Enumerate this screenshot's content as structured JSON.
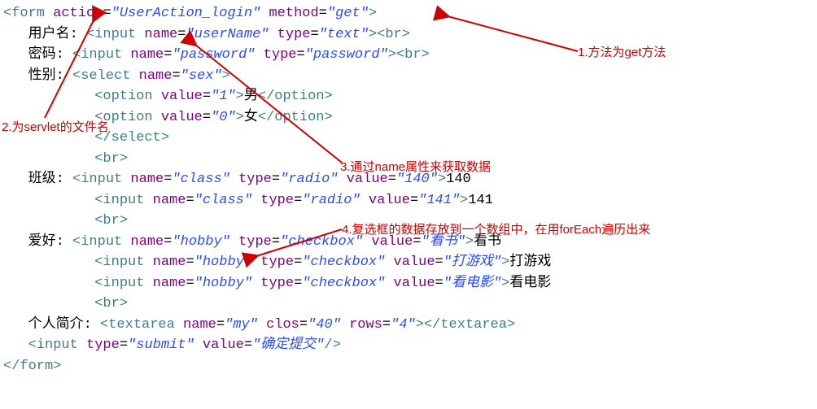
{
  "code": {
    "l1_tag_open": "<form",
    "l1_attr1": " action",
    "l1_eq1": "=",
    "l1_val1": "\"UserAction_login\"",
    "l1_attr2": " method",
    "l1_eq2": "=",
    "l1_val2": "\"get\"",
    "l1_close": ">",
    "l2_pre": "   用户名: ",
    "l2_tag": "<input",
    "l2_a1": " name",
    "l2_e1": "=",
    "l2_v1": "\"userName\"",
    "l2_a2": " type",
    "l2_e2": "=",
    "l2_v2": "\"text\"",
    "l2_close": ">",
    "l2_br": "<br>",
    "l3_pre": "   密码: ",
    "l3_tag": "<input",
    "l3_a1": " name",
    "l3_e1": "=",
    "l3_v1": "\"password\"",
    "l3_a2": " type",
    "l3_e2": "=",
    "l3_v2": "\"password\"",
    "l3_close": ">",
    "l3_br": "<br>",
    "l4_pre": "   性别: ",
    "l4_tag": "<select",
    "l4_a1": " name",
    "l4_e1": "=",
    "l4_v1": "\"sex\"",
    "l4_close": ">",
    "l5_pre": "           ",
    "l5_tag": "<option",
    "l5_a1": " value",
    "l5_e1": "=",
    "l5_v1": "\"1\"",
    "l5_close": ">",
    "l5_text": "男",
    "l5_end": "</option>",
    "l6_pre": "           ",
    "l6_tag": "<option",
    "l6_a1": " value",
    "l6_e1": "=",
    "l6_v1": "\"0\"",
    "l6_close": ">",
    "l6_text": "女",
    "l6_end": "</option>",
    "l7_pre": "           ",
    "l7_end": "</select>",
    "l8_pre": "           ",
    "l8_br": "<br>",
    "l9_pre": "   班级: ",
    "l9_tag": "<input",
    "l9_a1": " name",
    "l9_e1": "=",
    "l9_v1": "\"class\"",
    "l9_a2": " type",
    "l9_e2": "=",
    "l9_v2": "\"radio\"",
    "l9_a3": " value",
    "l9_e3": "=",
    "l9_v3": "\"140\"",
    "l9_close": ">",
    "l9_text": "140",
    "l10_pre": "           ",
    "l10_tag": "<input",
    "l10_a1": " name",
    "l10_e1": "=",
    "l10_v1": "\"class\"",
    "l10_a2": " type",
    "l10_e2": "=",
    "l10_v2": "\"radio\"",
    "l10_a3": " value",
    "l10_e3": "=",
    "l10_v3": "\"141\"",
    "l10_close": ">",
    "l10_text": "141",
    "l11_pre": "           ",
    "l11_br": "<br>",
    "l12_pre": "   爱好: ",
    "l12_tag": "<input",
    "l12_a1": " name",
    "l12_e1": "=",
    "l12_v1": "\"hobby\"",
    "l12_a2": " type",
    "l12_e2": "=",
    "l12_v2": "\"checkbox\"",
    "l12_a3": " value",
    "l12_e3": "=",
    "l12_v3": "\"看书\"",
    "l12_close": ">",
    "l12_text": "看书",
    "l13_pre": "           ",
    "l13_tag": "<input",
    "l13_a1": " name",
    "l13_e1": "=",
    "l13_v1": "\"hobby\"",
    "l13_a2": " type",
    "l13_e2": "=",
    "l13_v2": "\"checkbox\"",
    "l13_a3": " value",
    "l13_e3": "=",
    "l13_v3": "\"打游戏\"",
    "l13_close": ">",
    "l13_text": "打游戏",
    "l14_pre": "           ",
    "l14_tag": "<input",
    "l14_a1": " name",
    "l14_e1": "=",
    "l14_v1": "\"hobby\"",
    "l14_a2": " type",
    "l14_e2": "=",
    "l14_v2": "\"checkbox\"",
    "l14_a3": " value",
    "l14_e3": "=",
    "l14_v3": "\"看电影\"",
    "l14_close": ">",
    "l14_text": "看电影",
    "l15_pre": "           ",
    "l15_br": "<br>",
    "l16_pre": "   个人简介: ",
    "l16_tag": "<textarea",
    "l16_a1": " name",
    "l16_e1": "=",
    "l16_v1": "\"my\"",
    "l16_a2": " clos",
    "l16_e2": "=",
    "l16_v2": "\"40\"",
    "l16_a3": " rows",
    "l16_e3": "=",
    "l16_v3": "\"4\"",
    "l16_close": ">",
    "l16_end": "</textarea>",
    "l17_pre": "   ",
    "l17_tag": "<input",
    "l17_a1": " type",
    "l17_e1": "=",
    "l17_v1": "\"submit\"",
    "l17_a2": " value",
    "l17_e2": "=",
    "l17_v2": "\"确定提交\"",
    "l17_close": "/>",
    "l18_end": "</form>"
  },
  "annotations": {
    "a1": "1.方法为get方法",
    "a2": "2.为servlet的文件名",
    "a3": "3.通过name属性来获取数据",
    "a4": "4.复选框的数据存放到一个数组中，在用forEach遍历出来"
  }
}
